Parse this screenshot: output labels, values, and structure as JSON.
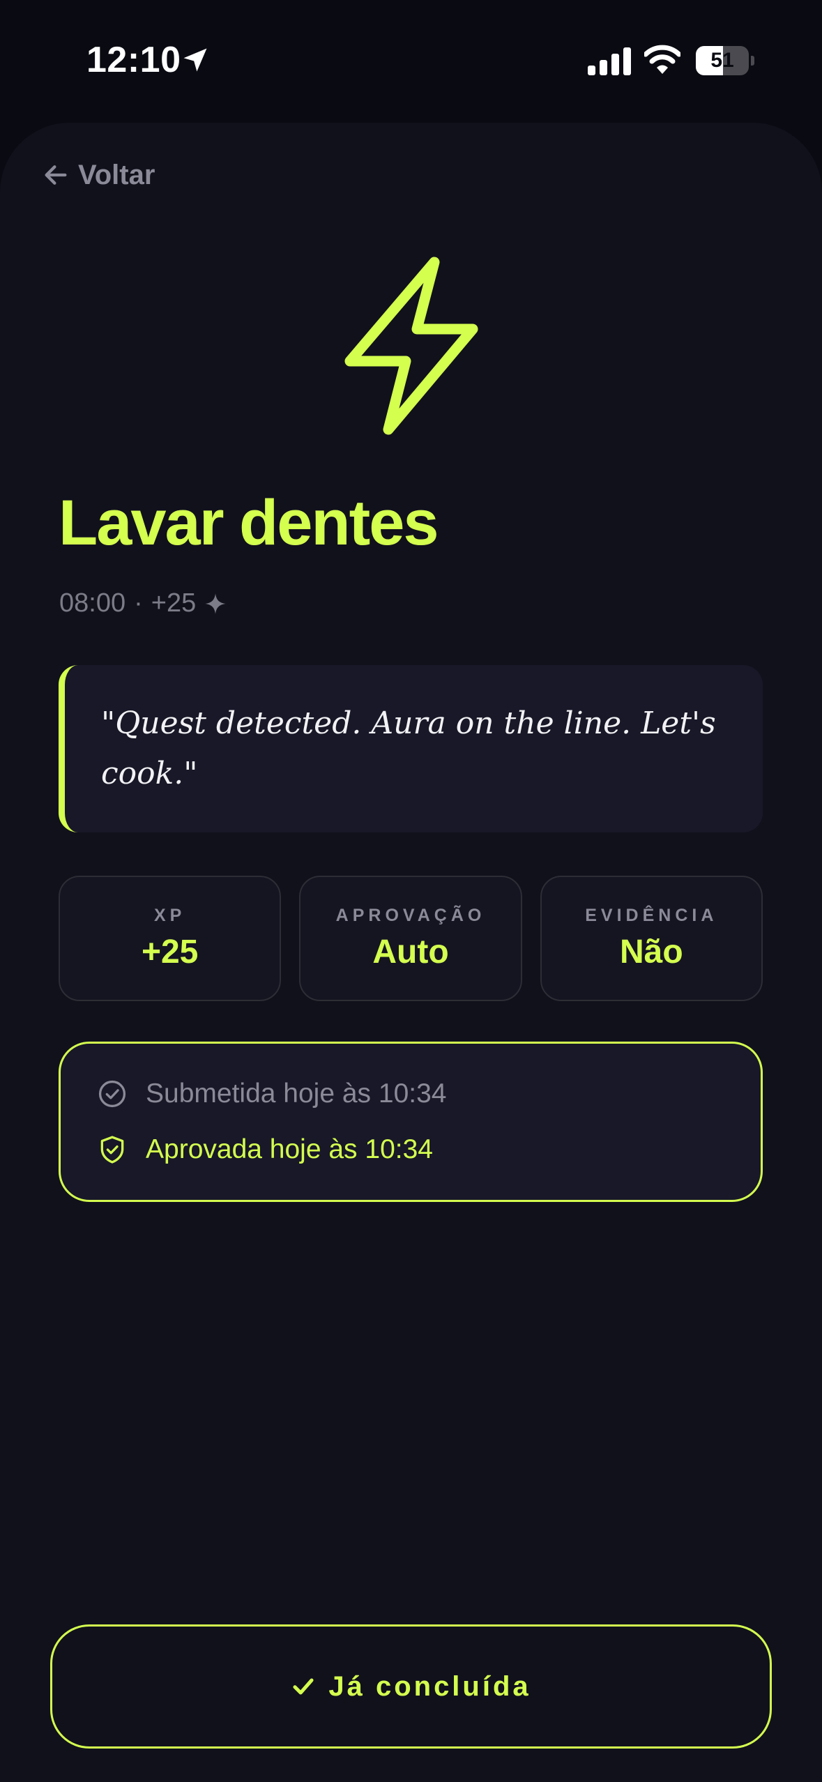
{
  "status_bar": {
    "time": "12:10",
    "battery_level": "51",
    "battery_fraction": 0.51,
    "icons": [
      "location-arrow-icon",
      "cellular-signal-icon",
      "wifi-icon",
      "battery-icon"
    ]
  },
  "nav": {
    "back_label": "Voltar"
  },
  "quest": {
    "icon": "lightning-bolt-icon",
    "title": "Lavar dentes",
    "time": "08:00",
    "separator": "·",
    "reward": "+25",
    "reward_icon": "sparkle-icon",
    "quote": "\"Quest detected. Aura on the line. Let's cook.\""
  },
  "stats": [
    {
      "label": "XP",
      "value": "+25"
    },
    {
      "label": "APROVAÇÃO",
      "value": "Auto"
    },
    {
      "label": "EVIDÊNCIA",
      "value": "Não"
    }
  ],
  "history": {
    "submitted": "Submetida hoje às 10:34",
    "approved": "Aprovada hoje às 10:34"
  },
  "action": {
    "label": "Já concluída",
    "icon": "checkmark-icon"
  },
  "colors": {
    "accent": "#d4ff4f",
    "background": "#0a0a12",
    "surface": "#11111c",
    "card": "#181828",
    "muted_text": "#8a8a98"
  }
}
